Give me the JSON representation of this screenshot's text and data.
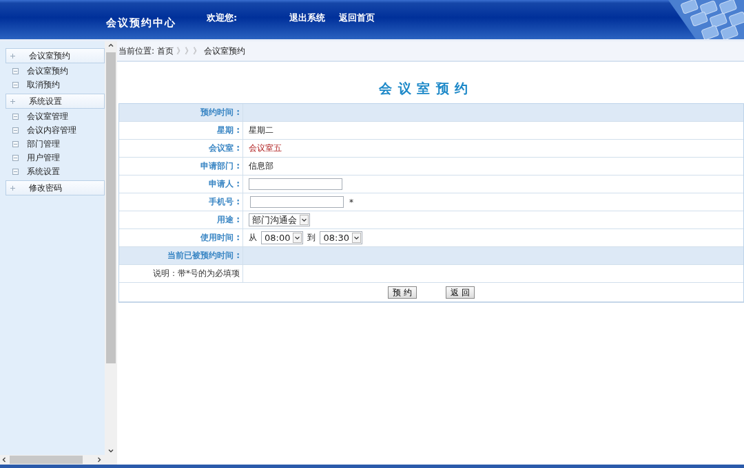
{
  "header": {
    "title": "会议预约中心",
    "welcome": "欢迎您:",
    "links": [
      "退出系统",
      "返回首页"
    ]
  },
  "sidebar": {
    "groups": [
      {
        "label": "会议室预约",
        "children": [
          {
            "label": "会议室预约"
          },
          {
            "label": "取消预约"
          }
        ]
      },
      {
        "label": "系统设置",
        "children": [
          {
            "label": "会议室管理"
          },
          {
            "label": "会议内容管理"
          },
          {
            "label": "部门管理"
          },
          {
            "label": "用户管理"
          },
          {
            "label": "系统设置"
          }
        ]
      },
      {
        "label": "修改密码"
      }
    ]
  },
  "breadcrumb": {
    "prefix": "当前位置:",
    "home": "首页",
    "separator": "》》》",
    "current": "会议室预约"
  },
  "form": {
    "title": "会 议 室 预 约",
    "rows": [
      {
        "kind": "section",
        "label": "预约时间 :"
      },
      {
        "kind": "text",
        "label": "星期 :",
        "value": "星期二"
      },
      {
        "kind": "link",
        "label": "会议室 :",
        "value": "会议室五"
      },
      {
        "kind": "text",
        "label": "申请部门 :",
        "value": "信息部"
      },
      {
        "kind": "input",
        "label": "申请人 :"
      },
      {
        "kind": "input",
        "label": "手机号 :",
        "required_mark": "*"
      },
      {
        "kind": "select",
        "label": "用途 :",
        "value": "部门沟通会"
      },
      {
        "kind": "timerange",
        "label": "使用时间 :",
        "from_label": "从",
        "from": "08:00",
        "to_label": "到",
        "to": "08:30"
      },
      {
        "kind": "section",
        "label": "当前已被预约时间 :"
      },
      {
        "kind": "note",
        "label": "说明：带*号的为必填项"
      }
    ],
    "buttons": [
      "预 约",
      "返 回"
    ]
  }
}
